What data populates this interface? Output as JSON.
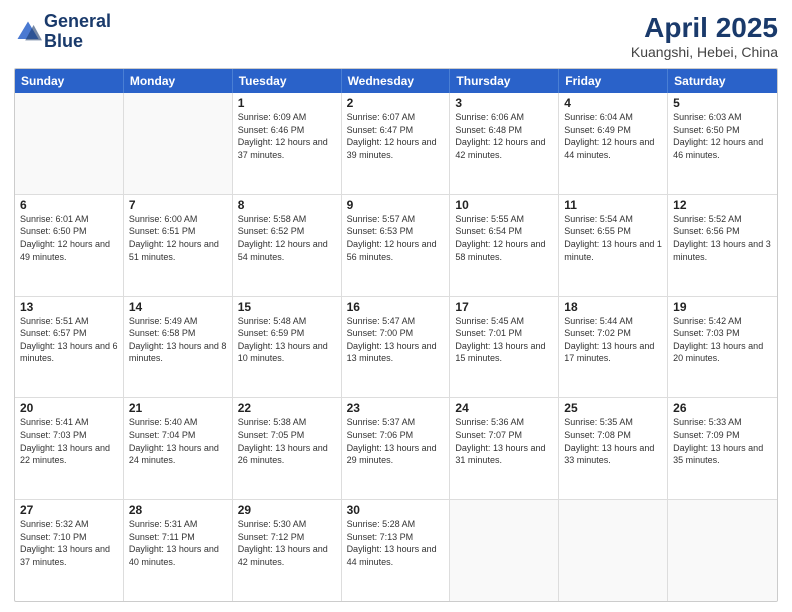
{
  "header": {
    "logo_line1": "General",
    "logo_line2": "Blue",
    "month_year": "April 2025",
    "location": "Kuangshi, Hebei, China"
  },
  "weekdays": [
    "Sunday",
    "Monday",
    "Tuesday",
    "Wednesday",
    "Thursday",
    "Friday",
    "Saturday"
  ],
  "weeks": [
    [
      {
        "day": "",
        "empty": true
      },
      {
        "day": "",
        "empty": true
      },
      {
        "day": "1",
        "sunrise": "Sunrise: 6:09 AM",
        "sunset": "Sunset: 6:46 PM",
        "daylight": "Daylight: 12 hours and 37 minutes."
      },
      {
        "day": "2",
        "sunrise": "Sunrise: 6:07 AM",
        "sunset": "Sunset: 6:47 PM",
        "daylight": "Daylight: 12 hours and 39 minutes."
      },
      {
        "day": "3",
        "sunrise": "Sunrise: 6:06 AM",
        "sunset": "Sunset: 6:48 PM",
        "daylight": "Daylight: 12 hours and 42 minutes."
      },
      {
        "day": "4",
        "sunrise": "Sunrise: 6:04 AM",
        "sunset": "Sunset: 6:49 PM",
        "daylight": "Daylight: 12 hours and 44 minutes."
      },
      {
        "day": "5",
        "sunrise": "Sunrise: 6:03 AM",
        "sunset": "Sunset: 6:50 PM",
        "daylight": "Daylight: 12 hours and 46 minutes."
      }
    ],
    [
      {
        "day": "6",
        "sunrise": "Sunrise: 6:01 AM",
        "sunset": "Sunset: 6:50 PM",
        "daylight": "Daylight: 12 hours and 49 minutes."
      },
      {
        "day": "7",
        "sunrise": "Sunrise: 6:00 AM",
        "sunset": "Sunset: 6:51 PM",
        "daylight": "Daylight: 12 hours and 51 minutes."
      },
      {
        "day": "8",
        "sunrise": "Sunrise: 5:58 AM",
        "sunset": "Sunset: 6:52 PM",
        "daylight": "Daylight: 12 hours and 54 minutes."
      },
      {
        "day": "9",
        "sunrise": "Sunrise: 5:57 AM",
        "sunset": "Sunset: 6:53 PM",
        "daylight": "Daylight: 12 hours and 56 minutes."
      },
      {
        "day": "10",
        "sunrise": "Sunrise: 5:55 AM",
        "sunset": "Sunset: 6:54 PM",
        "daylight": "Daylight: 12 hours and 58 minutes."
      },
      {
        "day": "11",
        "sunrise": "Sunrise: 5:54 AM",
        "sunset": "Sunset: 6:55 PM",
        "daylight": "Daylight: 13 hours and 1 minute."
      },
      {
        "day": "12",
        "sunrise": "Sunrise: 5:52 AM",
        "sunset": "Sunset: 6:56 PM",
        "daylight": "Daylight: 13 hours and 3 minutes."
      }
    ],
    [
      {
        "day": "13",
        "sunrise": "Sunrise: 5:51 AM",
        "sunset": "Sunset: 6:57 PM",
        "daylight": "Daylight: 13 hours and 6 minutes."
      },
      {
        "day": "14",
        "sunrise": "Sunrise: 5:49 AM",
        "sunset": "Sunset: 6:58 PM",
        "daylight": "Daylight: 13 hours and 8 minutes."
      },
      {
        "day": "15",
        "sunrise": "Sunrise: 5:48 AM",
        "sunset": "Sunset: 6:59 PM",
        "daylight": "Daylight: 13 hours and 10 minutes."
      },
      {
        "day": "16",
        "sunrise": "Sunrise: 5:47 AM",
        "sunset": "Sunset: 7:00 PM",
        "daylight": "Daylight: 13 hours and 13 minutes."
      },
      {
        "day": "17",
        "sunrise": "Sunrise: 5:45 AM",
        "sunset": "Sunset: 7:01 PM",
        "daylight": "Daylight: 13 hours and 15 minutes."
      },
      {
        "day": "18",
        "sunrise": "Sunrise: 5:44 AM",
        "sunset": "Sunset: 7:02 PM",
        "daylight": "Daylight: 13 hours and 17 minutes."
      },
      {
        "day": "19",
        "sunrise": "Sunrise: 5:42 AM",
        "sunset": "Sunset: 7:03 PM",
        "daylight": "Daylight: 13 hours and 20 minutes."
      }
    ],
    [
      {
        "day": "20",
        "sunrise": "Sunrise: 5:41 AM",
        "sunset": "Sunset: 7:03 PM",
        "daylight": "Daylight: 13 hours and 22 minutes."
      },
      {
        "day": "21",
        "sunrise": "Sunrise: 5:40 AM",
        "sunset": "Sunset: 7:04 PM",
        "daylight": "Daylight: 13 hours and 24 minutes."
      },
      {
        "day": "22",
        "sunrise": "Sunrise: 5:38 AM",
        "sunset": "Sunset: 7:05 PM",
        "daylight": "Daylight: 13 hours and 26 minutes."
      },
      {
        "day": "23",
        "sunrise": "Sunrise: 5:37 AM",
        "sunset": "Sunset: 7:06 PM",
        "daylight": "Daylight: 13 hours and 29 minutes."
      },
      {
        "day": "24",
        "sunrise": "Sunrise: 5:36 AM",
        "sunset": "Sunset: 7:07 PM",
        "daylight": "Daylight: 13 hours and 31 minutes."
      },
      {
        "day": "25",
        "sunrise": "Sunrise: 5:35 AM",
        "sunset": "Sunset: 7:08 PM",
        "daylight": "Daylight: 13 hours and 33 minutes."
      },
      {
        "day": "26",
        "sunrise": "Sunrise: 5:33 AM",
        "sunset": "Sunset: 7:09 PM",
        "daylight": "Daylight: 13 hours and 35 minutes."
      }
    ],
    [
      {
        "day": "27",
        "sunrise": "Sunrise: 5:32 AM",
        "sunset": "Sunset: 7:10 PM",
        "daylight": "Daylight: 13 hours and 37 minutes."
      },
      {
        "day": "28",
        "sunrise": "Sunrise: 5:31 AM",
        "sunset": "Sunset: 7:11 PM",
        "daylight": "Daylight: 13 hours and 40 minutes."
      },
      {
        "day": "29",
        "sunrise": "Sunrise: 5:30 AM",
        "sunset": "Sunset: 7:12 PM",
        "daylight": "Daylight: 13 hours and 42 minutes."
      },
      {
        "day": "30",
        "sunrise": "Sunrise: 5:28 AM",
        "sunset": "Sunset: 7:13 PM",
        "daylight": "Daylight: 13 hours and 44 minutes."
      },
      {
        "day": "",
        "empty": true
      },
      {
        "day": "",
        "empty": true
      },
      {
        "day": "",
        "empty": true
      }
    ]
  ]
}
